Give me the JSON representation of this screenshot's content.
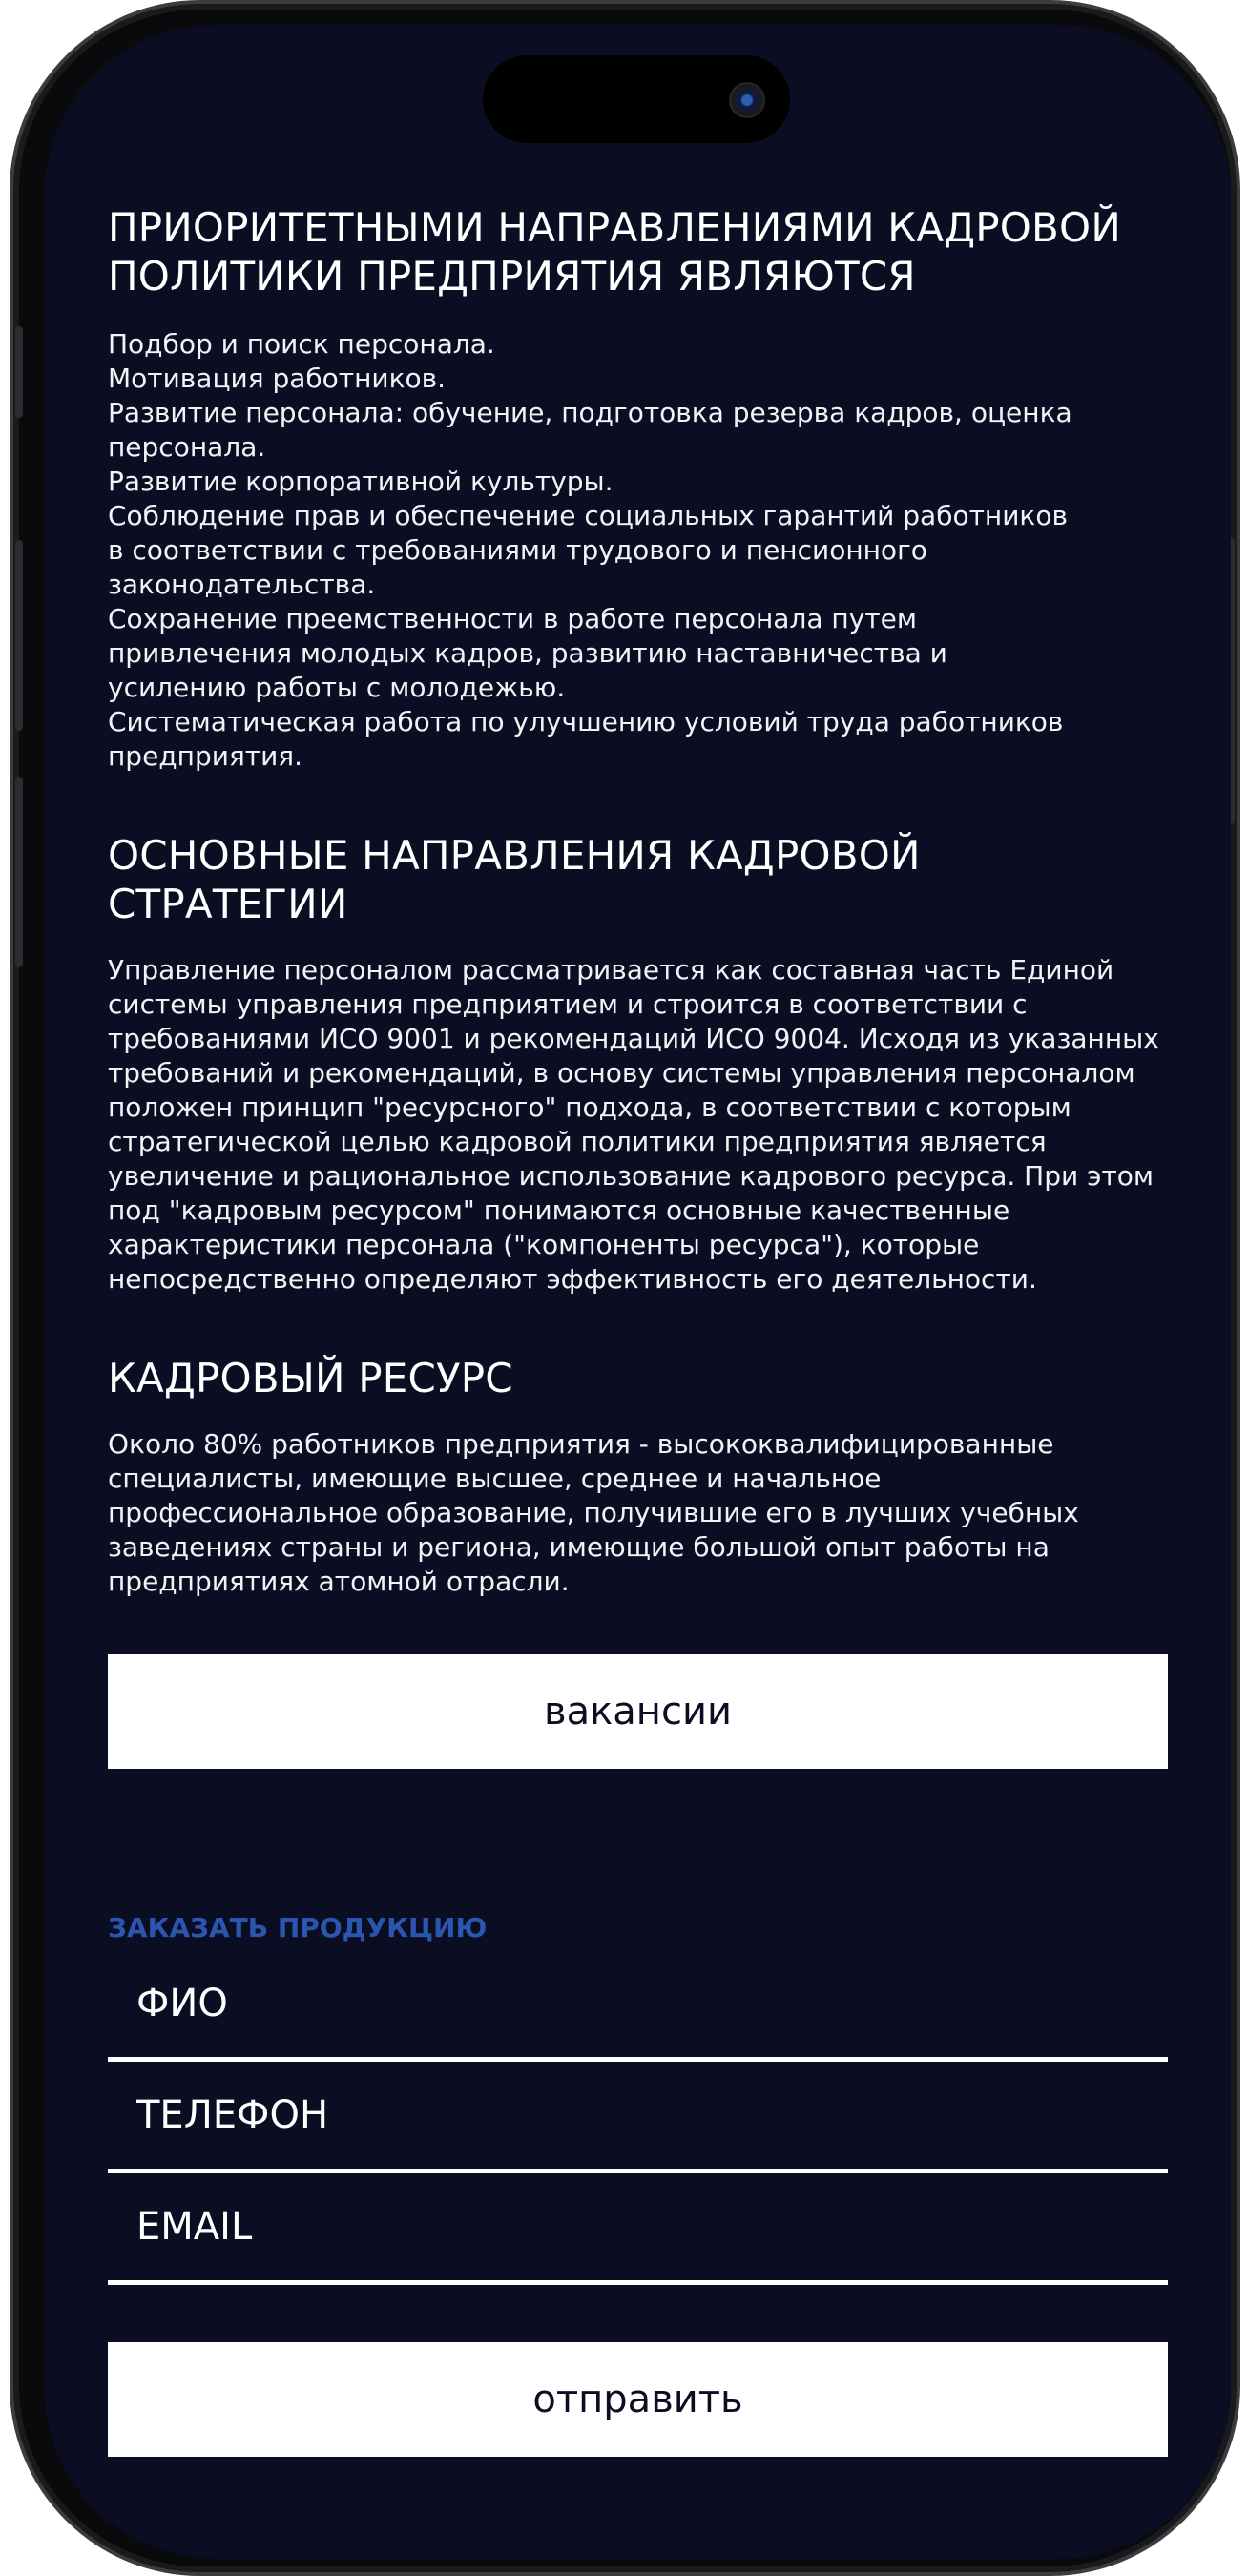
{
  "sections": [
    {
      "title_lines": [
        "ПРИОРИТЕТНЫМИ НАПРАВЛЕНИЯМИ КАДРОВОЙ",
        "ПОЛИТИКИ ПРЕДПРИЯТИЯ ЯВЛЯЮТСЯ"
      ],
      "body_lines": [
        "Подбор и поиск персонала.",
        "Мотивация работников.",
        "Развитие персонала: обучение, подготовка резерва кадров, оценка",
        "персонала.",
        "Развитие корпоративной культуры.",
        "Соблюдение прав и обеспечение социальных гарантий работников",
        "в соответствии с требованиями трудового и пенсионного",
        "законодательства.",
        "Сохранение преемственности в работе персонала путем",
        "привлечения молодых кадров, развитию наставничества и",
        "усилению работы с молодежью.",
        "Систематическая работа по улучшению условий труда работников",
        "предприятия."
      ]
    },
    {
      "title_lines": [
        "ОСНОВНЫЕ НАПРАВЛЕНИЯ КАДРОВОЙ СТРАТЕГИИ"
      ],
      "body_lines": [
        "Управление персоналом рассматривается как составная часть Единой",
        "системы управления предприятием и строится в соответствии с",
        "требованиями ИСО 9001 и рекомендаций ИСО 9004. Исходя из указанных",
        "требований и рекомендаций, в основу системы управления персоналом",
        "положен принцип \"ресурсного\" подхода, в соответствии с которым",
        "стратегической целью кадровой политики предприятия является",
        "увеличение и рациональное использование кадрового ресурса. При этом",
        "под \"кадровым ресурсом\" понимаются основные качественные",
        "характеристики персонала (\"компоненты ресурса\"), которые",
        "непосредственно определяют эффективность его деятельности."
      ]
    },
    {
      "title_lines": [
        "КАДРОВЫЙ РЕСУРС"
      ],
      "body_lines": [
        "Около 80% работников предприятия - высококвалифицированные",
        "специалисты, имеющие высшее, среднее и начальное",
        "профессиональное образование, получившие его в лучших учебных",
        "заведениях страны и региона, имеющие большой опыт работы на",
        "предприятиях атомной отрасли."
      ]
    }
  ],
  "vacancies_button": "вакансии",
  "order_form": {
    "title": "ЗАКАЗАТЬ ПРОДУКЦИЮ",
    "fields": {
      "name": {
        "placeholder": "ФИО",
        "value": ""
      },
      "phone": {
        "placeholder": "ТЕЛЕФОН",
        "value": ""
      },
      "email": {
        "placeholder": "EMAIL",
        "value": ""
      }
    },
    "submit_label": "отправить"
  },
  "colors": {
    "background": "#0b0e22",
    "text": "#ffffff",
    "accent": "#2a56b0",
    "button_bg": "#ffffff"
  },
  "icons": {
    "camera": "front-camera-icon"
  }
}
